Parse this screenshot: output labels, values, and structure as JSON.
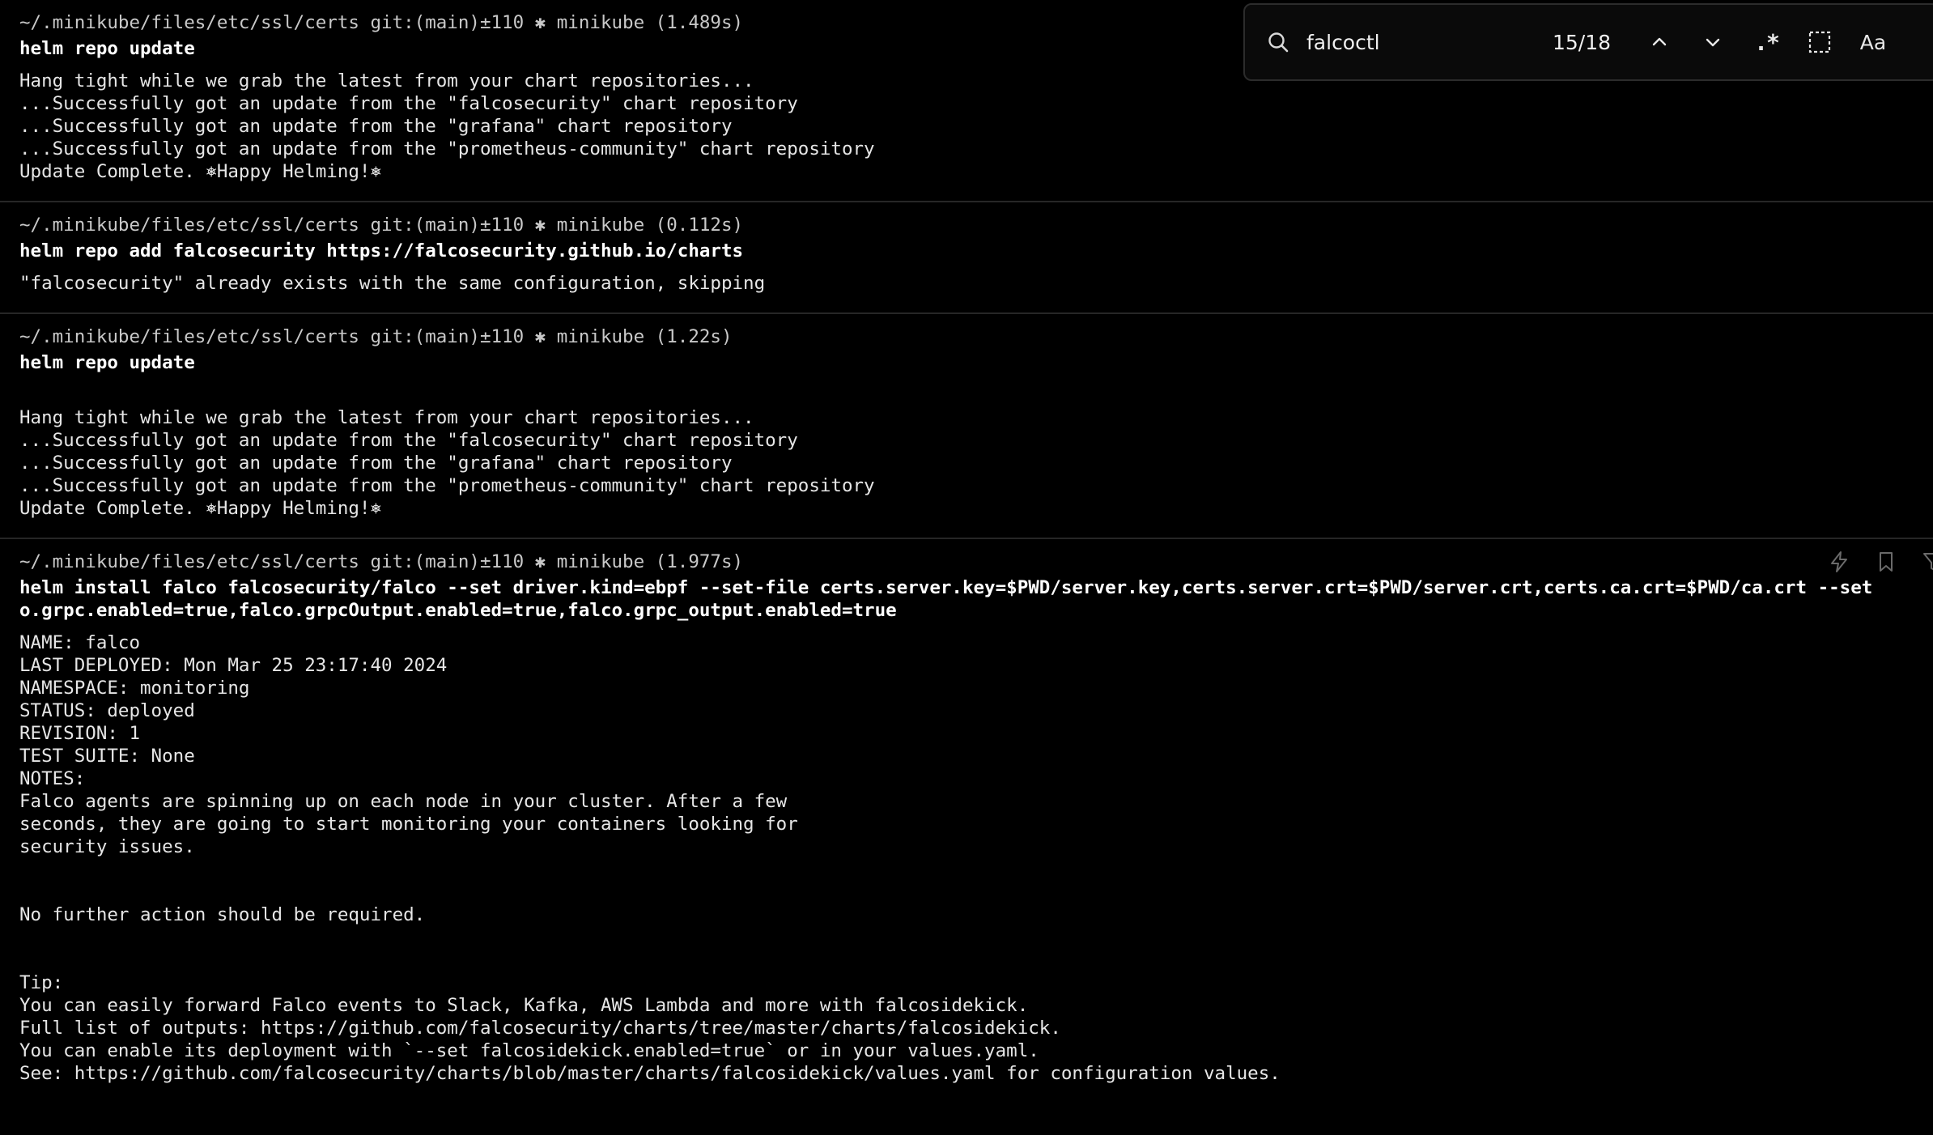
{
  "blocks": [
    {
      "prompt": "~/.minikube/files/etc/ssl/certs git:(main)±110 ✱ minikube (1.489s)",
      "command": "helm repo update",
      "output": [
        "Hang tight while we grab the latest from your chart repositories...",
        "...Successfully got an update from the \"falcosecurity\" chart repository",
        "...Successfully got an update from the \"grafana\" chart repository",
        "...Successfully got an update from the \"prometheus-community\" chart repository",
        "Update Complete. ⎈Happy Helming!⎈"
      ]
    },
    {
      "prompt": "~/.minikube/files/etc/ssl/certs git:(main)±110 ✱ minikube (0.112s)",
      "command": "helm repo add falcosecurity https://falcosecurity.github.io/charts",
      "output": [
        "\"falcosecurity\" already exists with the same configuration, skipping"
      ]
    },
    {
      "prompt": "~/.minikube/files/etc/ssl/certs git:(main)±110 ✱ minikube (1.22s)",
      "command": "helm repo update",
      "output": [
        "",
        "Hang tight while we grab the latest from your chart repositories...",
        "...Successfully got an update from the \"falcosecurity\" chart repository",
        "...Successfully got an update from the \"grafana\" chart repository",
        "...Successfully got an update from the \"prometheus-community\" chart repository",
        "Update Complete. ⎈Happy Helming!⎈"
      ]
    },
    {
      "prompt": "~/.minikube/files/etc/ssl/certs git:(main)±110 ✱ minikube (1.977s)",
      "command": "helm install falco falcosecurity/falco --set driver.kind=ebpf --set-file certs.server.key=$PWD/server.key,certs.server.crt=$PWD/server.crt,certs.ca.crt=$PWD/ca.crt --set\no.grpc.enabled=true,falco.grpcOutput.enabled=true,falco.grpc_output.enabled=true",
      "output": [
        "NAME: falco",
        "LAST DEPLOYED: Mon Mar 25 23:17:40 2024",
        "NAMESPACE: monitoring",
        "STATUS: deployed",
        "REVISION: 1",
        "TEST SUITE: None",
        "NOTES:",
        "Falco agents are spinning up on each node in your cluster. After a few",
        "seconds, they are going to start monitoring your containers looking for",
        "security issues.",
        "",
        "",
        "No further action should be required.",
        "",
        "",
        "Tip:",
        "You can easily forward Falco events to Slack, Kafka, AWS Lambda and more with falcosidekick.",
        "Full list of outputs: https://github.com/falcosecurity/charts/tree/master/charts/falcosidekick.",
        "You can enable its deployment with `--set falcosidekick.enabled=true` or in your values.yaml.",
        "See: https://github.com/falcosecurity/charts/blob/master/charts/falcosidekick/values.yaml for configuration values."
      ],
      "actions": [
        "lightning-icon",
        "bookmark-icon",
        "filter-icon"
      ]
    }
  ],
  "find": {
    "query": "falcoctl",
    "count": "15/18",
    "regex_label": ".*",
    "case_label": "Aa"
  }
}
